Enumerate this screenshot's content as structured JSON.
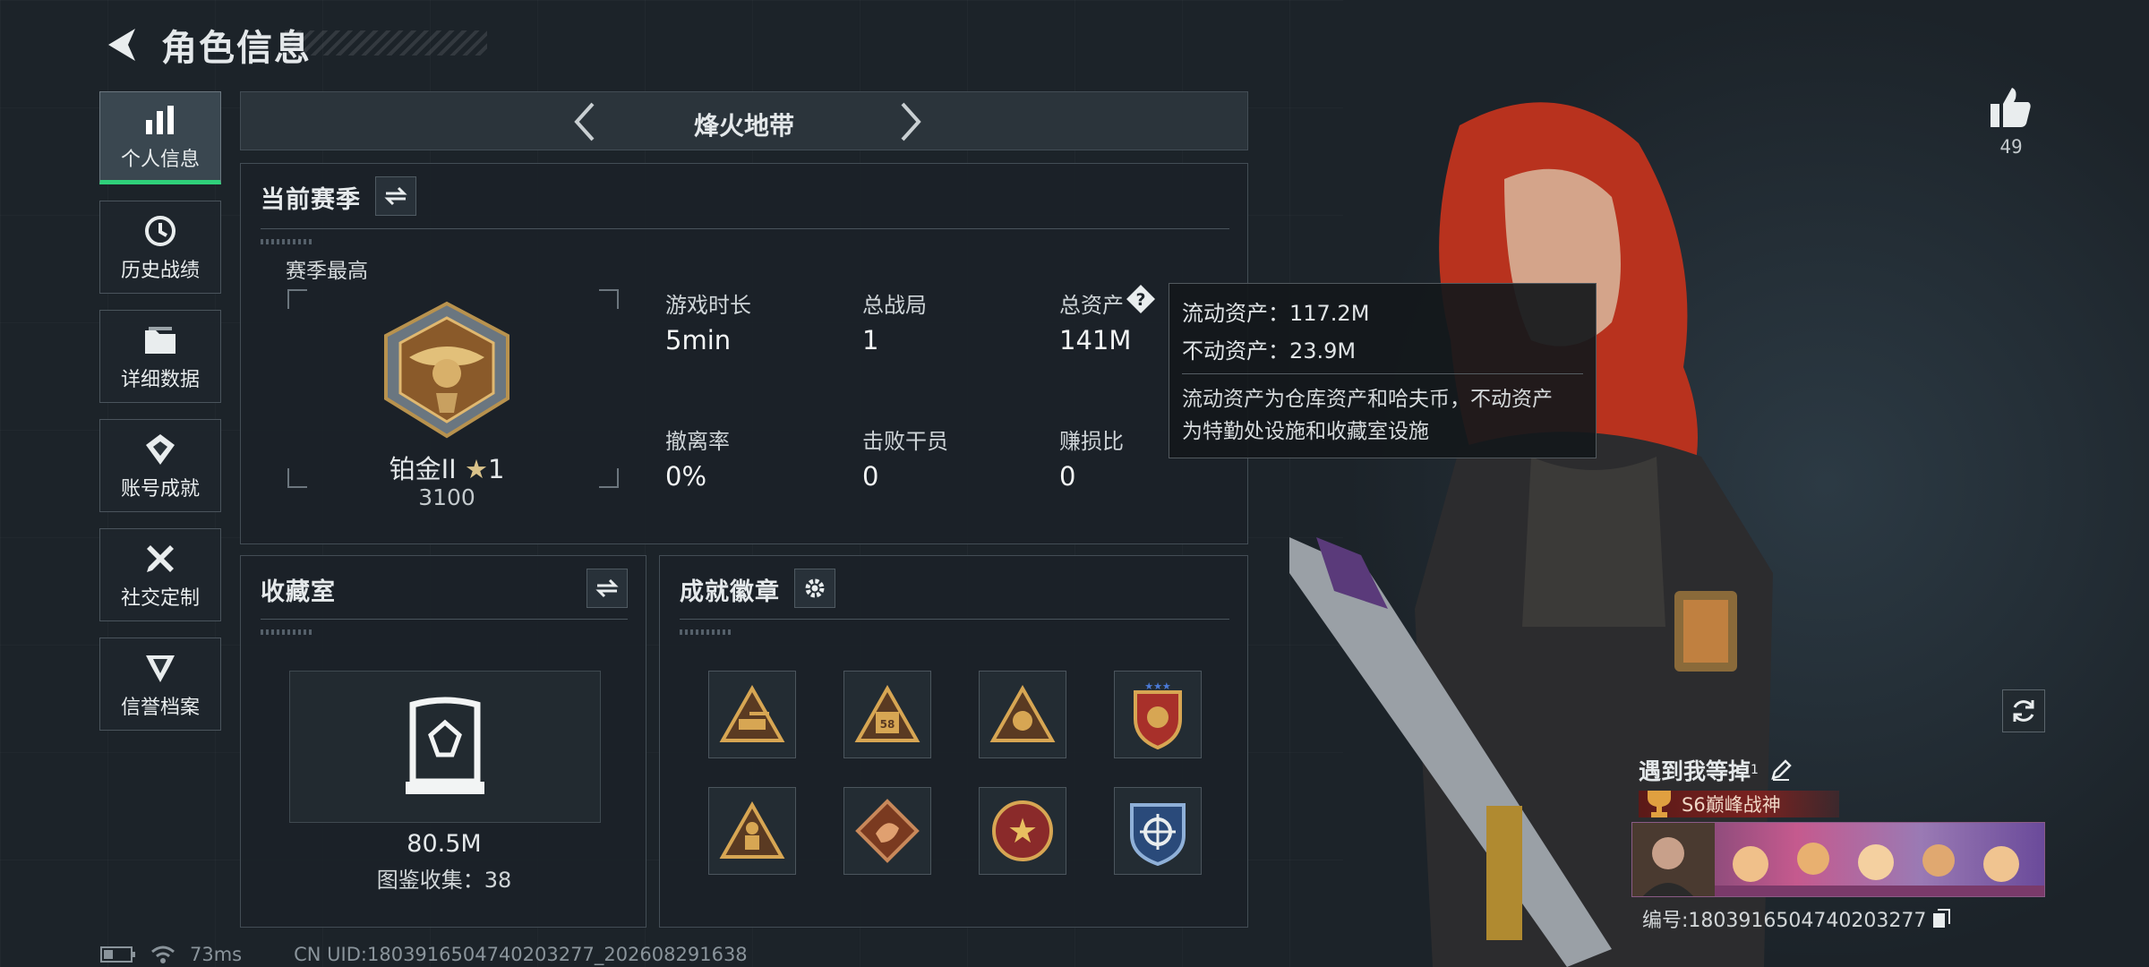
{
  "header": {
    "title": "角色信息"
  },
  "nav": [
    {
      "label": "个人信息",
      "icon": "bar-chart-icon",
      "active": true
    },
    {
      "label": "历史战绩",
      "icon": "history-icon"
    },
    {
      "label": "详细数据",
      "icon": "folder-icon"
    },
    {
      "label": "账号成就",
      "icon": "achievement-icon"
    },
    {
      "label": "社交定制",
      "icon": "tools-icon"
    },
    {
      "label": "信誉档案",
      "icon": "reputation-icon"
    }
  ],
  "mode": {
    "name": "烽火地带"
  },
  "season": {
    "title": "当前赛季",
    "best_label": "赛季最高",
    "rank_name": "铂金II",
    "rank_stars": "1",
    "rank_score": "3100",
    "stats": [
      {
        "label": "游戏时长",
        "value": "5min"
      },
      {
        "label": "总战局",
        "value": "1"
      },
      {
        "label": "总资产",
        "value": "141M"
      },
      {
        "label": "撤离率",
        "value": "0%"
      },
      {
        "label": "击败干员",
        "value": "0"
      },
      {
        "label": "赚损比",
        "value": "0"
      }
    ]
  },
  "tooltip": {
    "liquid": "流动资产：117.2M",
    "fixed": "不动资产：23.9M",
    "note_line1": "流动资产为仓库资产和哈夫币，不动资产",
    "note_line2": "为特勤处设施和收藏室设施"
  },
  "collection": {
    "title": "收藏室",
    "value": "80.5M",
    "catalog": "图鉴收集：38"
  },
  "badges": {
    "title": "成就徽章",
    "items": [
      {
        "icon": "tank-badge-icon"
      },
      {
        "icon": "58-badge-icon"
      },
      {
        "icon": "hand-badge-icon"
      },
      {
        "icon": "star-shield-badge-icon"
      },
      {
        "icon": "soldier-badge-icon"
      },
      {
        "icon": "dragon-badge-icon"
      },
      {
        "icon": "star-emblem-badge-icon"
      },
      {
        "icon": "crosshair-badge-icon"
      }
    ]
  },
  "status": {
    "ping": "73ms",
    "uid": "CN UID:1803916504740203277_202608291638"
  },
  "player": {
    "likes": "49",
    "name": "遇到我等掉",
    "name_sup": "1",
    "title": "S6巅峰战神",
    "id": "编号:1803916504740203277"
  }
}
